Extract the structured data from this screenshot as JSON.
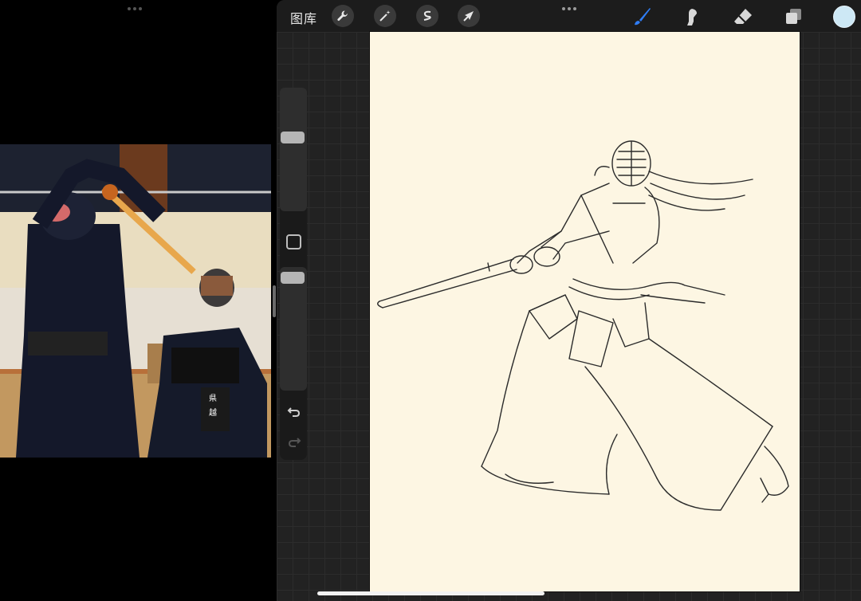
{
  "toolbar": {
    "gallery_label": "图库",
    "left_tools": [
      "wrench-icon",
      "magic-wand-icon",
      "selection-icon",
      "transform-arrow-icon"
    ],
    "right_tools": [
      "brush-icon",
      "smudge-icon",
      "eraser-icon",
      "layers-icon"
    ],
    "active_tool": "brush-icon",
    "current_color": "#cde8f5",
    "brush_color": "#2f7df6"
  },
  "sidebar": {
    "brush_size_level": 0.12,
    "opacity_level": 0.18
  },
  "colors": {
    "canvas_bg": "#fdf6e3",
    "app_bg": "#222222",
    "line": "#2b2b2b"
  }
}
